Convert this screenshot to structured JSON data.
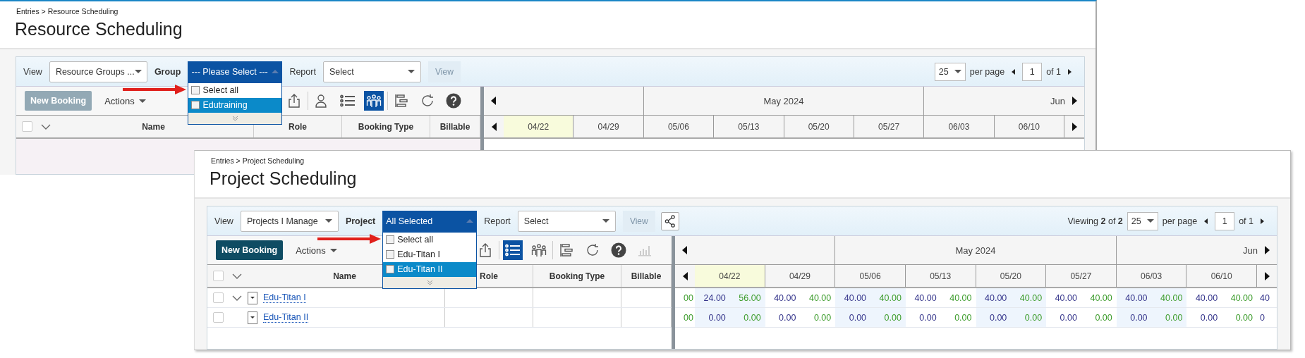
{
  "windows": [
    {
      "breadcrumb": "Entries > Resource Scheduling",
      "title": "Resource Scheduling",
      "filters": [
        {
          "kind": "select",
          "label": "View",
          "value": "Resource Groups ..."
        },
        {
          "kind": "multiselect",
          "label": "Group",
          "value": "--- Please Select ---",
          "open": true,
          "options": [
            {
              "label": "Select all",
              "checked": false,
              "selected": false
            },
            {
              "label": "Edutraining",
              "checked": false,
              "selected": true
            }
          ]
        },
        {
          "kind": "select",
          "label": "Report",
          "value": "Select"
        }
      ],
      "view_button": {
        "label": "View",
        "disabled": true
      },
      "page_size": "25",
      "per_page": "per page",
      "page": "1",
      "page_of": "of 1",
      "new_booking": {
        "label": "New Booking",
        "disabled": true
      },
      "actions": "Actions",
      "tools": [
        {
          "kind": "export",
          "selected": false,
          "disabled": false
        },
        {
          "kind": "person",
          "selected": false,
          "disabled": false
        },
        {
          "kind": "list",
          "selected": false,
          "disabled": false
        },
        {
          "kind": "people",
          "selected": true,
          "disabled": false
        },
        {
          "kind": "gantt",
          "selected": false,
          "disabled": false
        },
        {
          "kind": "refresh",
          "selected": false,
          "disabled": false
        },
        {
          "kind": "help",
          "selected": false,
          "disabled": false
        }
      ],
      "header_checked": false,
      "columns": [
        "Name",
        "Role",
        "Booking Type",
        "Billable"
      ],
      "week_groups": [
        {
          "weeks": [
            {
              "label": "04/22",
              "selected": true
            },
            {
              "label": "04/29",
              "selected": false
            }
          ]
        },
        {
          "label": "May 2024",
          "weeks": [
            {
              "label": "05/06",
              "selected": false
            },
            {
              "label": "05/13",
              "selected": false
            },
            {
              "label": "05/20",
              "selected": false
            },
            {
              "label": "05/27",
              "selected": false
            }
          ]
        },
        {
          "label": "Jun",
          "weeks": [
            {
              "label": "06/03",
              "selected": false
            },
            {
              "label": "06/10",
              "selected": false
            }
          ]
        }
      ]
    },
    {
      "breadcrumb": "Entries > Project Scheduling",
      "title": "Project Scheduling",
      "filters": [
        {
          "kind": "select",
          "label": "View",
          "value": "Projects I Manage"
        },
        {
          "kind": "multiselect",
          "label": "Project",
          "value": "All Selected",
          "open": true,
          "options": [
            {
              "label": "Select all",
              "checked": false,
              "selected": false
            },
            {
              "label": "Edu-Titan I",
              "checked": false,
              "selected": false
            },
            {
              "label": "Edu-Titan II",
              "checked": false,
              "selected": true
            }
          ]
        },
        {
          "kind": "select",
          "label": "Report",
          "value": "Select"
        }
      ],
      "view_button": {
        "label": "View",
        "disabled": true
      },
      "share_button": true,
      "viewing": "Viewing **2** of **2**",
      "page_size": "25",
      "per_page": "per page",
      "page": "1",
      "page_of": "of 1",
      "new_booking": {
        "label": "New Booking",
        "disabled": false
      },
      "actions": "Actions",
      "tools": [
        {
          "kind": "export",
          "selected": false,
          "disabled": false
        },
        {
          "kind": "list",
          "selected": true,
          "disabled": false
        },
        {
          "kind": "people",
          "selected": false,
          "disabled": false
        },
        {
          "kind": "gantt",
          "selected": false,
          "disabled": false
        },
        {
          "kind": "refresh",
          "selected": false,
          "disabled": false
        },
        {
          "kind": "help",
          "selected": false,
          "disabled": false
        },
        {
          "kind": "chart",
          "selected": false,
          "disabled": true
        }
      ],
      "header_checked": false,
      "columns": [
        "Name",
        "Role",
        "Booking Type",
        "Billable"
      ],
      "week_groups": [
        {
          "weeks": [
            {
              "label": "04/22",
              "selected": true
            },
            {
              "label": "04/29",
              "selected": false
            }
          ]
        },
        {
          "label": "May 2024",
          "weeks": [
            {
              "label": "05/06",
              "selected": false
            },
            {
              "label": "05/13",
              "selected": false
            },
            {
              "label": "05/20",
              "selected": false
            },
            {
              "label": "05/27",
              "selected": false
            }
          ]
        },
        {
          "label": "Jun",
          "weeks": [
            {
              "label": "06/03",
              "selected": false
            },
            {
              "label": "06/10",
              "selected": false
            }
          ]
        }
      ],
      "rows": [
        {
          "name": "Edu-Titan I",
          "checked": false,
          "expanded": true,
          "lead": "00",
          "values": [
            "24.00",
            "56.00",
            "40.00",
            "40.00",
            "40.00",
            "40.00",
            "40.00",
            "40.00",
            "40.00",
            "40.00",
            "40.00",
            "40.00",
            "40.00",
            "40.00",
            "40.00",
            "40.00"
          ],
          "tail": "40"
        },
        {
          "name": "Edu-Titan II",
          "checked": false,
          "lead": "00",
          "values": [
            "0.00",
            "0.00",
            "0.00",
            "0.00",
            "0.00",
            "0.00",
            "0.00",
            "0.00",
            "0.00",
            "0.00",
            "0.00",
            "0.00",
            "0.00",
            "0.00",
            "0.00",
            "0.00"
          ],
          "tail": "0"
        }
      ]
    }
  ]
}
